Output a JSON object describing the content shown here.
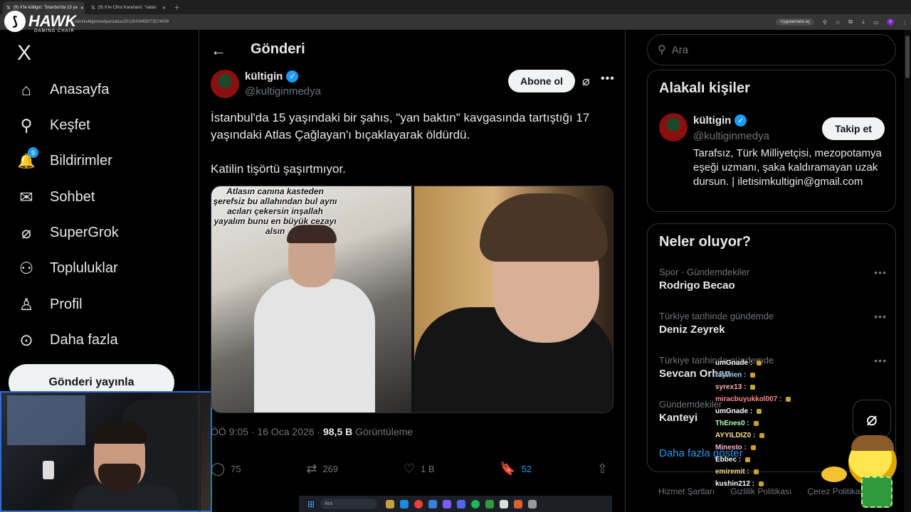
{
  "browser": {
    "tabs": [
      {
        "title": "(9) X'te kültigin: \"İstanbul'da 15 ya",
        "active": true
      },
      {
        "title": "(9) X'te Cihıs Karahanlı: \"vatan",
        "active": false
      }
    ],
    "url": "x.com/kultiginmedya/status/2012043465073574009",
    "open_app_label": "Uygulamada aç"
  },
  "streamer_logo": {
    "brand": "HAWK",
    "sub": "GAMING CHAIR"
  },
  "nav": {
    "logo": "X",
    "items": [
      {
        "label": "Anasayfa",
        "icon": "home-icon",
        "glyph": "⌂"
      },
      {
        "label": "Keşfet",
        "icon": "search-icon",
        "glyph": "⚲"
      },
      {
        "label": "Bildirimler",
        "icon": "bell-icon",
        "glyph": "🔔",
        "badge": "9"
      },
      {
        "label": "Sohbet",
        "icon": "mail-icon",
        "glyph": "✉"
      },
      {
        "label": "SuperGrok",
        "icon": "grok-icon",
        "glyph": "⌀"
      },
      {
        "label": "Topluluklar",
        "icon": "communities-icon",
        "glyph": "⚇"
      },
      {
        "label": "Profil",
        "icon": "profile-icon",
        "glyph": "♙"
      },
      {
        "label": "Daha fazla",
        "icon": "more-circle-icon",
        "glyph": "⊙"
      }
    ],
    "post_button": "Gönderi yayınla"
  },
  "post": {
    "header_title": "Gönderi",
    "author_name": "kültigin",
    "author_handle": "@kultiginmedya",
    "subscribe_label": "Abone ol",
    "text_1": "İstanbul'da 15 yaşındaki bir şahıs, \"yan baktın\" kavgasında tartıştığı 17 yaşındaki Atlas Çağlayan'ı bıçaklayarak öldürdü.",
    "text_2": "Katilin tişörtü şaşırtmıyor.",
    "image_overlay_text": "Atlasın canına kasteden şerefsiz bu allahından bul aynı acıları çekersin inşallah yayalım bunu en büyük cezayı alsın",
    "time": "ÖÖ 9:05 · 16 Oca 2026 · ",
    "views_value": "98,5 B",
    "views_label": " Görüntüleme",
    "actions": {
      "replies": "75",
      "reposts": "269",
      "likes": "1 B",
      "bookmarks": "52"
    }
  },
  "sidebar": {
    "search_placeholder": "Ara",
    "related_title": "Alakalı kişiler",
    "related_name": "kültigin",
    "related_handle": "@kultiginmedya",
    "follow_label": "Takip et",
    "related_bio": "Tarafsız, Türk Milliyetçisi, mezopotamya eşeği uzmanı, şaka kaldıramayan uzak dursun. | iletisimkultigin@gmail.com",
    "trends_title": "Neler oluyor?",
    "trends": [
      {
        "category": "Spor · Gündemdekiler",
        "name": "Rodrigo Becao"
      },
      {
        "category": "Türkiye tarihinde gündemde",
        "name": "Deniz Zeyrek"
      },
      {
        "category": "Türkiye tarihinde gündemde",
        "name": "Sevcan Orhan"
      },
      {
        "category": "Gündemdekiler",
        "name": "Kanteyi"
      }
    ],
    "show_more": "Daha fazla göster",
    "footer": [
      "Hizmet Şartları",
      "Gizlilik Politikası",
      "Çerez Politikası"
    ]
  },
  "chat_overlay": [
    {
      "user": "umGnade :",
      "color": "#ffffff"
    },
    {
      "user": "raywien :",
      "color": "#9ad0ff"
    },
    {
      "user": "syrex13 :",
      "color": "#ffb0b0"
    },
    {
      "user": "miracbuyukkol007 :",
      "color": "#ff8a8a"
    },
    {
      "user": "umGnade :",
      "color": "#ffffff"
    },
    {
      "user": "ThEnes0 :",
      "color": "#b0ffb0"
    },
    {
      "user": "AYYILDIZ0 :",
      "color": "#ffe08a"
    },
    {
      "user": "Minesto :",
      "color": "#ffb0d0"
    },
    {
      "user": "Ebbec :",
      "color": "#ffffff"
    },
    {
      "user": "emiremit :",
      "color": "#ffe08a"
    },
    {
      "user": "kushin212 :",
      "color": "#ffffff"
    }
  ],
  "taskbar": {
    "search_label": "Ara"
  }
}
